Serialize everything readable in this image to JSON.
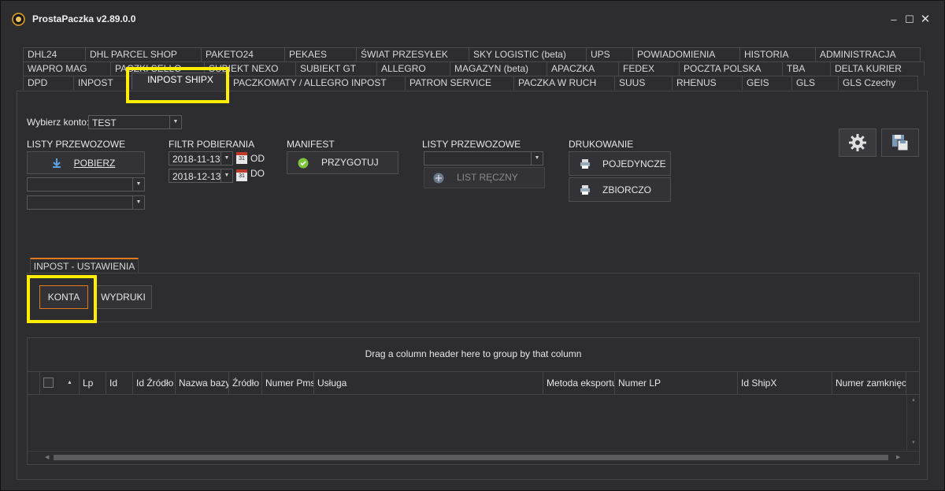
{
  "window": {
    "title": "ProstaPaczka v2.89.0.0"
  },
  "tabs": {
    "row1": [
      "DHL24",
      "DHL PARCEL SHOP",
      "PAKETO24",
      "PEKAES",
      "ŚWIAT PRZESYŁEK",
      "SKY LOGISTIC (beta)",
      "UPS",
      "POWIADOMIENIA",
      "HISTORIA",
      "ADMINISTRACJA"
    ],
    "row2": [
      "WAPRO MAG",
      "PACZKI SELLO",
      "SUBIEKT NEXO",
      "SUBIEKT GT",
      "ALLEGRO",
      "MAGAZYN (beta)",
      "APACZKA",
      "FEDEX",
      "POCZTA POLSKA",
      "TBA",
      "DELTA KURIER"
    ],
    "row3": [
      "DPD",
      "INPOST",
      "INPOST SHIPX",
      "PACZKOMATY / ALLEGRO INPOST",
      "PATRON SERVICE",
      "PACZKA W RUCH",
      "SUUS",
      "RHENUS",
      "GEIS",
      "GLS",
      "GLS Czechy"
    ],
    "active": "INPOST SHIPX"
  },
  "account": {
    "label": "Wybierz konto:",
    "value": "TEST"
  },
  "waybills_left": {
    "heading": "LISTY PRZEWOZOWE",
    "download_label": "POBIERZ"
  },
  "filter": {
    "heading": "FILTR POBIERANIA",
    "from_date": "2018-11-13",
    "from_label": "OD",
    "to_date": "2018-12-13",
    "to_label": "DO"
  },
  "manifest": {
    "heading": "MANIFEST",
    "prepare_label": "PRZYGOTUJ"
  },
  "waybills_right": {
    "heading": "LISTY PRZEWOZOWE",
    "manual_label": "LIST RĘCZNY"
  },
  "printing": {
    "heading": "DRUKOWANIE",
    "single_label": "POJEDYNCZE",
    "batch_label": "ZBIORCZO"
  },
  "settings_panel": {
    "tab_label": "INPOST - USTAWIENIA",
    "accounts_label": "KONTA",
    "prints_label": "WYDRUKI"
  },
  "grid": {
    "group_hint": "Drag a column header here to group by that column",
    "columns": [
      "Lp",
      "Id",
      "Id Źródło",
      "Nazwa bazy",
      "Źródło",
      "Numer Pms",
      "Usługa",
      "Metoda eksportu",
      "Numer LP",
      "Id ShipX",
      "Numer zamknięcia"
    ]
  },
  "colors": {
    "highlight": "#ffee00",
    "accent_orange": "#e07a1f",
    "background": "#2d2d30"
  },
  "icons": [
    "app-logo-icon",
    "download-icon",
    "calendar-icon",
    "check-circle-icon",
    "plus-circle-icon",
    "printer-icon",
    "gear-icon",
    "save-icon"
  ]
}
